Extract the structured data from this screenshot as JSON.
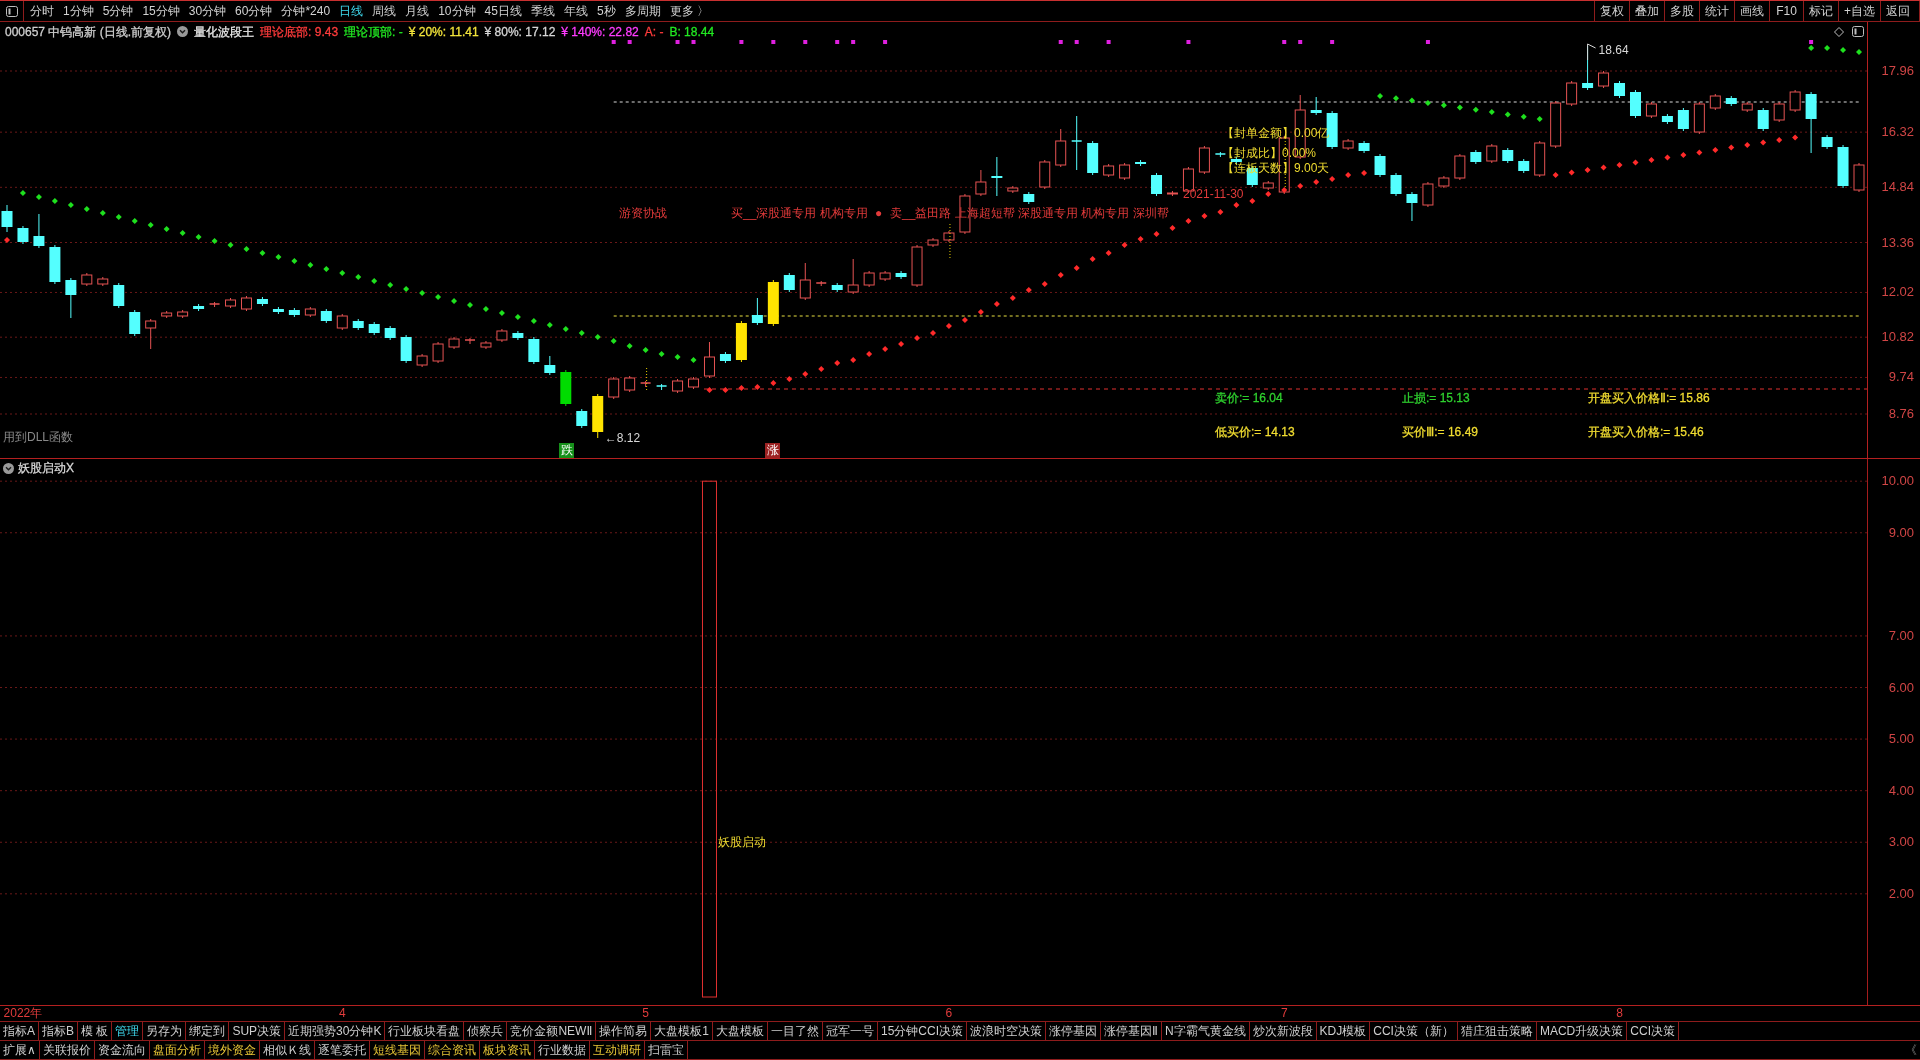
{
  "toolbar": {
    "periods": [
      {
        "label": "分时",
        "selected": false
      },
      {
        "label": "1分钟",
        "selected": false
      },
      {
        "label": "5分钟",
        "selected": false
      },
      {
        "label": "15分钟",
        "selected": false
      },
      {
        "label": "30分钟",
        "selected": false
      },
      {
        "label": "60分钟",
        "selected": false
      },
      {
        "label": "分钟*240",
        "selected": false
      },
      {
        "label": "日线",
        "selected": true
      },
      {
        "label": "周线",
        "selected": false
      },
      {
        "label": "月线",
        "selected": false
      },
      {
        "label": "10分钟",
        "selected": false
      },
      {
        "label": "45日线",
        "selected": false
      },
      {
        "label": "季线",
        "selected": false
      },
      {
        "label": "年线",
        "selected": false
      },
      {
        "label": "5秒",
        "selected": false
      },
      {
        "label": "多周期",
        "selected": false
      },
      {
        "label": "更多 〉",
        "selected": false
      }
    ],
    "actions": [
      "复权",
      "叠加",
      "多股",
      "统计",
      "画线",
      "F10",
      "标记",
      "+自选",
      "返回"
    ]
  },
  "info_bar": {
    "security": "000657 中钨高新 (日线.前复权)",
    "indicator": "量化波段王",
    "readings": [
      {
        "text": "理论底部: 9.43",
        "color": "#ff3b3b"
      },
      {
        "text": "理论顶部: -",
        "color": "#22e822"
      },
      {
        "text": "¥ 20%: 11.41",
        "color": "#f2e33a"
      },
      {
        "text": "¥ 80%: 17.12",
        "color": "#d6d6d6"
      },
      {
        "text": "¥ 140%: 22.82",
        "color": "#ff3cff"
      },
      {
        "text": "A: -",
        "color": "#ff3b3b"
      },
      {
        "text": "B: 18.44",
        "color": "#22e822"
      }
    ]
  },
  "main_chart": {
    "price_axis": [
      "17.96",
      "16.32",
      "14.84",
      "13.36",
      "12.02",
      "10.82",
      "9.74",
      "8.76"
    ],
    "dll_note": "用到DLL函数",
    "low_label": "←8.12",
    "high_label": "18.64",
    "fall_tag": "跌",
    "rise_tag": "涨",
    "hot_money": "游资协战",
    "buy_seats": "买__深股通专用 机构专用",
    "bullet": "●",
    "sell_seats": "卖__益田路 上海超短帮 深股通专用 机构专用 深圳帮",
    "seat_date": "2021-11-30",
    "limit_stats": [
      "【封单金额】0.00亿",
      "【封成比】0.00%",
      "【连板天数】9.00天"
    ],
    "price_targets": [
      {
        "text": "卖价:= 16.04",
        "color": "#2ed02e"
      },
      {
        "text": "止损:= 15.13",
        "color": "#2ed02e"
      },
      {
        "text": "开盘买入价格Ⅱ:= 15.86",
        "color": "#f0dc30"
      },
      {
        "text": "低买价:= 14.13",
        "color": "#f0dc30"
      },
      {
        "text": "买价Ⅲ:= 16.49",
        "color": "#f0dc30"
      },
      {
        "text": "开盘买入价格:= 15.46",
        "color": "#f0dc30"
      }
    ]
  },
  "sub_chart": {
    "chart_data": {
      "type": "bar",
      "title": "妖股启动X",
      "grid": true,
      "categories": [
        null,
        "2022年",
        null,
        null,
        null,
        null,
        null,
        null,
        null,
        null,
        null,
        null,
        null,
        null,
        null,
        null,
        null,
        null,
        null,
        null,
        null,
        "4",
        null,
        null,
        null,
        null,
        null,
        null,
        null,
        null,
        null,
        null,
        null,
        null,
        null,
        null,
        null,
        null,
        null,
        null,
        "5",
        null,
        null,
        null,
        null,
        null,
        null,
        null,
        null,
        null,
        null,
        null,
        null,
        null,
        null,
        null,
        null,
        null,
        null,
        "6",
        null,
        null,
        null,
        null,
        null,
        null,
        null,
        null,
        null,
        null,
        null,
        null,
        null,
        null,
        null,
        null,
        null,
        null,
        null,
        null,
        "7",
        null,
        null,
        null,
        null,
        null,
        null,
        null,
        null,
        null,
        null,
        null,
        null,
        null,
        null,
        null,
        null,
        null,
        null,
        null,
        null,
        "8",
        null,
        null,
        null,
        null,
        null,
        null,
        null,
        null,
        null,
        null,
        null,
        null,
        null,
        null,
        null
      ],
      "ylim": [
        0,
        10.43
      ],
      "yticks": [
        {
          "value": 10,
          "label": "10.00"
        },
        {
          "value": 9,
          "label": "9.00"
        },
        {
          "value": 7,
          "label": "7.00"
        },
        {
          "value": 6,
          "label": "6.00"
        },
        {
          "value": 5,
          "label": "5.00"
        },
        {
          "value": 4,
          "label": "4.00"
        },
        {
          "value": 3,
          "label": "3.00"
        },
        {
          "value": 2,
          "label": "2.00"
        }
      ],
      "series": [
        {
          "color": "#e03030",
          "values": [
            null,
            null,
            null,
            null,
            null,
            null,
            null,
            null,
            null,
            null,
            null,
            null,
            null,
            null,
            null,
            null,
            null,
            null,
            null,
            null,
            null,
            null,
            null,
            null,
            null,
            null,
            null,
            null,
            null,
            null,
            null,
            null,
            null,
            null,
            null,
            null,
            null,
            null,
            null,
            null,
            null,
            null,
            null,
            null,
            10,
            null,
            null,
            null,
            null,
            null,
            null,
            null,
            null,
            null,
            null,
            null,
            null,
            null,
            null,
            null,
            null,
            null,
            null,
            null,
            null,
            null,
            null,
            null,
            null,
            null,
            null,
            null,
            null,
            null,
            null,
            null,
            null,
            null,
            null,
            null,
            null,
            null,
            null,
            null,
            null,
            null,
            null,
            null,
            null,
            null,
            null,
            null,
            null,
            null,
            null,
            null,
            null,
            null,
            null,
            null,
            null,
            null,
            null,
            null,
            null,
            null,
            null,
            null,
            null,
            null,
            null,
            null,
            null,
            null,
            null,
            null,
            null
          ]
        }
      ],
      "annotations": [
        "妖股启动"
      ]
    }
  },
  "formula_tabs": [
    {
      "label": "指标A",
      "selected": false
    },
    {
      "label": "指标B",
      "selected": false
    },
    {
      "label": "模 板",
      "selected": false
    },
    {
      "label": "管理",
      "selected": true
    },
    {
      "label": "另存为",
      "selected": false
    },
    {
      "label": "绑定到",
      "selected": false
    },
    {
      "label": "SUP决策",
      "selected": false
    },
    {
      "label": "近期强势30分钟K",
      "selected": false
    },
    {
      "label": "行业板块看盘",
      "selected": false
    },
    {
      "label": "侦察兵",
      "selected": false
    },
    {
      "label": "竞价金额NEWⅡ",
      "selected": false
    },
    {
      "label": "操作简易",
      "selected": false
    },
    {
      "label": "大盘模板1",
      "selected": false
    },
    {
      "label": "大盘模板",
      "selected": false
    },
    {
      "label": "一目了然",
      "selected": false
    },
    {
      "label": "冠军一号",
      "selected": false
    },
    {
      "label": "15分钟CCI决策",
      "selected": false
    },
    {
      "label": "波浪时空决策",
      "selected": false
    },
    {
      "label": "涨停基因",
      "selected": false
    },
    {
      "label": "涨停基因Ⅱ",
      "selected": false
    },
    {
      "label": "N字霸气黄金线",
      "selected": false
    },
    {
      "label": "炒次新波段",
      "selected": false
    },
    {
      "label": "KDJ模板",
      "selected": false
    },
    {
      "label": "CCI决策（新）",
      "selected": false
    },
    {
      "label": "猎庄狙击策略",
      "selected": false
    },
    {
      "label": "MACD升级决策",
      "selected": false
    },
    {
      "label": "CCI决策",
      "selected": false
    }
  ],
  "function_tabs": [
    {
      "label": "扩展∧",
      "highlighted": false
    },
    {
      "label": "关联报价",
      "highlighted": false
    },
    {
      "label": "资金流向",
      "highlighted": false
    },
    {
      "label": "盘面分析",
      "highlighted": true
    },
    {
      "label": "境外资金",
      "highlighted": true
    },
    {
      "label": "相似Ｋ线",
      "highlighted": false
    },
    {
      "label": "逐笔委托",
      "highlighted": false
    },
    {
      "label": "短线基因",
      "highlighted": true
    },
    {
      "label": "综合资讯",
      "highlighted": true
    },
    {
      "label": "板块资讯",
      "highlighted": true
    },
    {
      "label": "行业数据",
      "highlighted": false
    },
    {
      "label": "互动调研",
      "highlighted": true
    },
    {
      "label": "扫雷宝",
      "highlighted": false
    }
  ],
  "tab_scroll": "《"
}
